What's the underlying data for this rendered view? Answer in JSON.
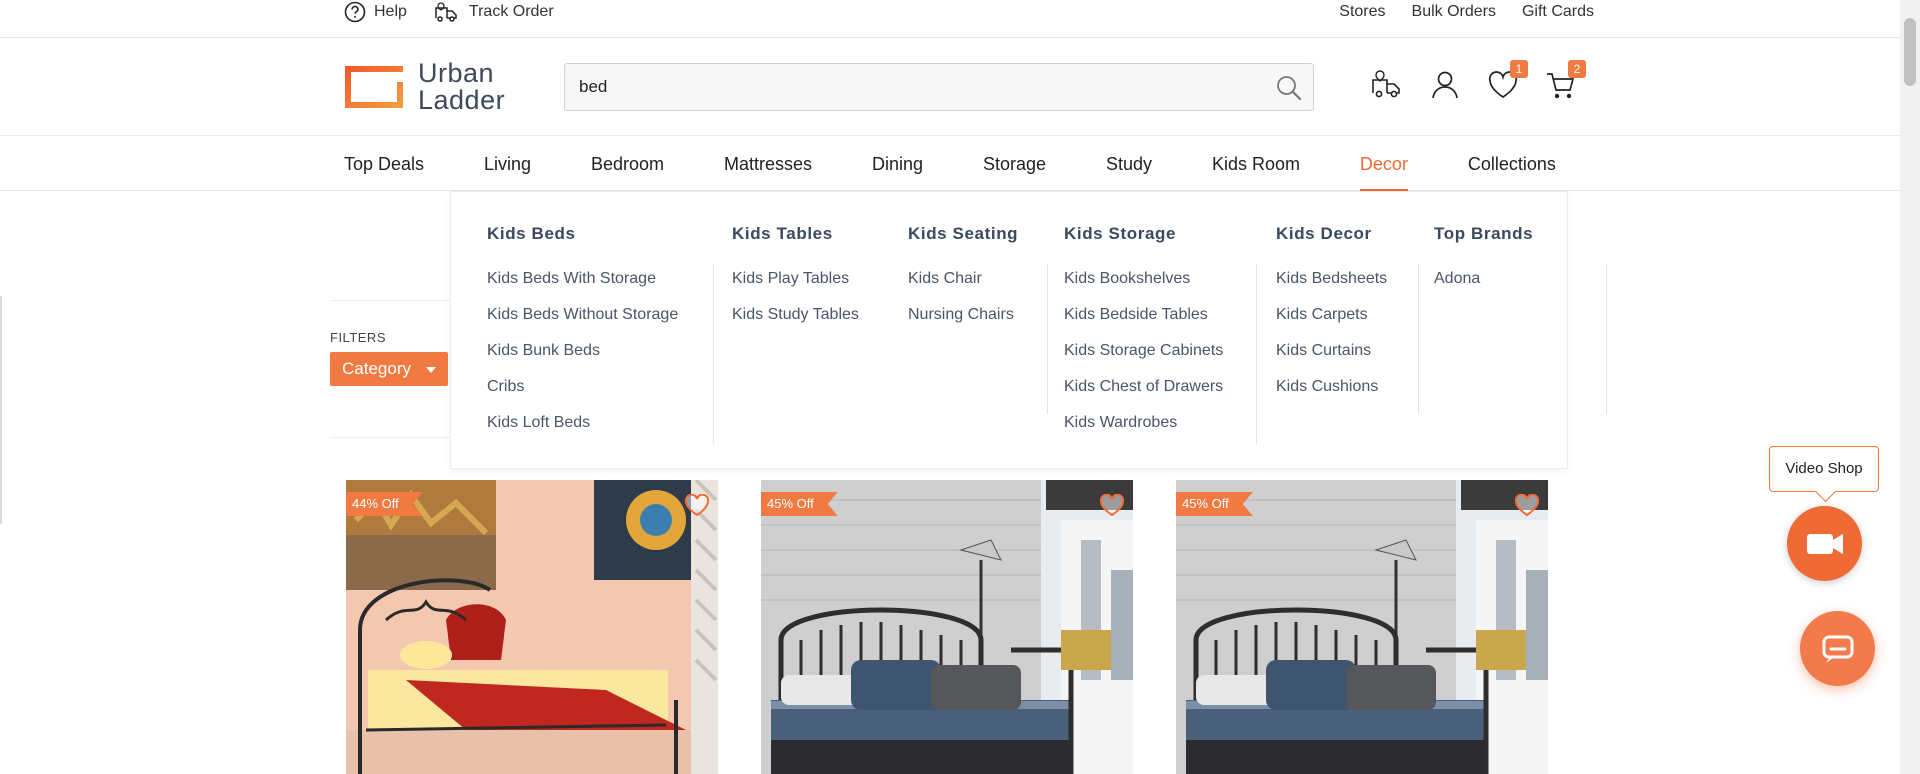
{
  "utility": {
    "help": "Help",
    "track_order": "Track Order",
    "stores": "Stores",
    "bulk_orders": "Bulk Orders",
    "gift_cards": "Gift Cards"
  },
  "brand": {
    "line1": "Urban",
    "line2": "Ladder",
    "accent": "#f06a35"
  },
  "search": {
    "value": "bed",
    "placeholder": ""
  },
  "header_icons": {
    "wishlist_count": "1",
    "cart_count": "2"
  },
  "nav": {
    "items": [
      "Top Deals",
      "Living",
      "Bedroom",
      "Mattresses",
      "Dining",
      "Storage",
      "Study",
      "Kids Room",
      "Decor",
      "Collections"
    ],
    "active": "Decor"
  },
  "dropdown": {
    "columns": [
      {
        "title": "Kids Beds",
        "links": [
          "Kids Beds With Storage",
          "Kids Beds Without Storage",
          "Kids Bunk Beds",
          "Cribs",
          "Kids Loft Beds"
        ]
      },
      {
        "title": "Kids Tables",
        "links": [
          "Kids Play Tables",
          "Kids Study Tables"
        ]
      },
      {
        "title": "Kids Seating",
        "links": [
          "Kids Chair",
          "Nursing Chairs"
        ]
      },
      {
        "title": "Kids Storage",
        "links": [
          "Kids Bookshelves",
          "Kids Bedside Tables",
          "Kids Storage Cabinets",
          "Kids Chest of Drawers",
          "Kids Wardrobes"
        ]
      },
      {
        "title": "Kids Decor",
        "links": [
          "Kids Bedsheets",
          "Kids Carpets",
          "Kids Curtains",
          "Kids Cushions"
        ]
      },
      {
        "title": "Top Brands",
        "links": [
          "Adona"
        ]
      }
    ]
  },
  "filters": {
    "label": "FILTERS",
    "category": "Category"
  },
  "products": [
    {
      "discount": "44% Off"
    },
    {
      "discount": "45% Off"
    },
    {
      "discount": "45% Off"
    }
  ],
  "widgets": {
    "video_shop": "Video Shop"
  },
  "icons": {
    "help": "help-circle-icon",
    "track": "delivery-truck-icon",
    "search": "search-icon",
    "wishlist": "heart-icon",
    "cart": "cart-icon",
    "account": "user-icon",
    "video": "video-camera-icon",
    "chat": "chat-icon"
  }
}
